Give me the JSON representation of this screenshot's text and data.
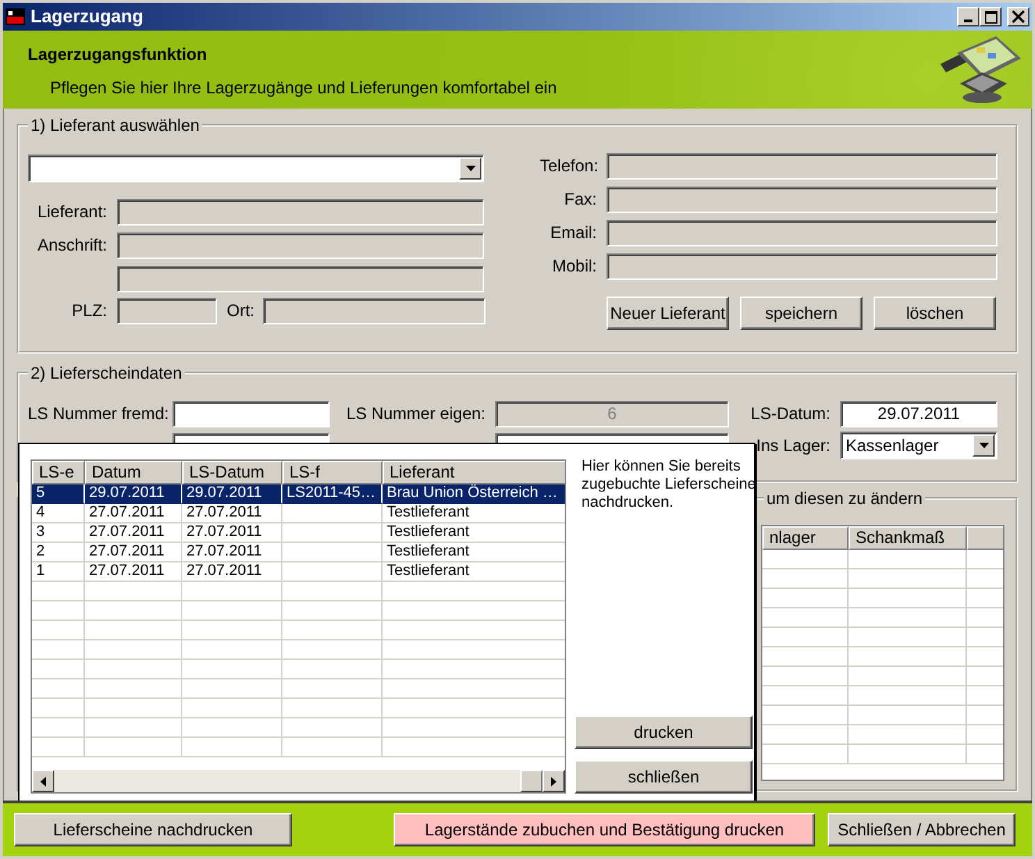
{
  "window": {
    "title": "Lagerzugang"
  },
  "header": {
    "title": "Lagerzugangsfunktion",
    "subtitle": "Pflegen Sie hier Ihre Lagerzugänge und Lieferungen komfortabel ein"
  },
  "supplier_group": {
    "legend": "1) Lieferant auswählen",
    "left_fields": [
      {
        "label": "Lieferant:"
      },
      {
        "label": "Anschrift:"
      }
    ],
    "plz_label": "PLZ:",
    "ort_label": "Ort:",
    "right_fields": [
      {
        "label": "Telefon:"
      },
      {
        "label": "Fax:"
      },
      {
        "label": "Email:"
      },
      {
        "label": "Mobil:"
      }
    ],
    "buttons": [
      "Neuer Lieferant",
      "speichern",
      "löschen"
    ]
  },
  "delivery_group": {
    "legend": "2) Lieferscheindaten",
    "fields": [
      {
        "label": "LS Nummer fremd:",
        "kind": "text",
        "disabled": false
      },
      {
        "label": "LS Nummer eigen:",
        "kind": "text",
        "disabled": true,
        "value": "6"
      },
      {
        "label": "LS-Datum:",
        "kind": "text",
        "disabled": false,
        "value": "29.07.2011"
      },
      {
        "kind": "text"
      },
      {
        "kind": "text"
      },
      {
        "label": "Ins Lager:",
        "kind": "combo",
        "disabled": false,
        "value": "Kassenlager"
      }
    ]
  },
  "article_group": {
    "legend": "um diesen zu ändern",
    "columns": [
      "nlager",
      "Schankmaß"
    ]
  },
  "popup": {
    "columns": [
      "LS-e",
      "Datum",
      "LS-Datum",
      "LS-f",
      "Lieferant"
    ],
    "rows": [
      {
        "cells": [
          "5",
          "29.07.2011",
          "29.07.2011",
          "LS2011-45…",
          "Brau Union Österreich …"
        ],
        "selected": true
      },
      {
        "cells": [
          "4",
          "27.07.2011",
          "27.07.2011",
          "",
          "Testlieferant"
        ],
        "selected": false
      },
      {
        "cells": [
          "3",
          "27.07.2011",
          "27.07.2011",
          "",
          "Testlieferant"
        ],
        "selected": false
      },
      {
        "cells": [
          "2",
          "27.07.2011",
          "27.07.2011",
          "",
          "Testlieferant"
        ],
        "selected": false
      },
      {
        "cells": [
          "1",
          "27.07.2011",
          "27.07.2011",
          "",
          "Testlieferant"
        ],
        "selected": false
      }
    ],
    "note": "Hier können Sie bereits zugebuchte Lieferscheine nachdrucken.",
    "buttons": [
      "drucken",
      "schließen"
    ]
  },
  "footer": {
    "buttons": [
      {
        "label": "Lieferscheine nachdrucken",
        "kind": "normal"
      },
      {
        "label": "Lagerstände zubuchen und Bestätigung drucken",
        "kind": "highlight"
      },
      {
        "label": "Schließen / Abbrechen",
        "kind": "normal"
      }
    ]
  }
}
